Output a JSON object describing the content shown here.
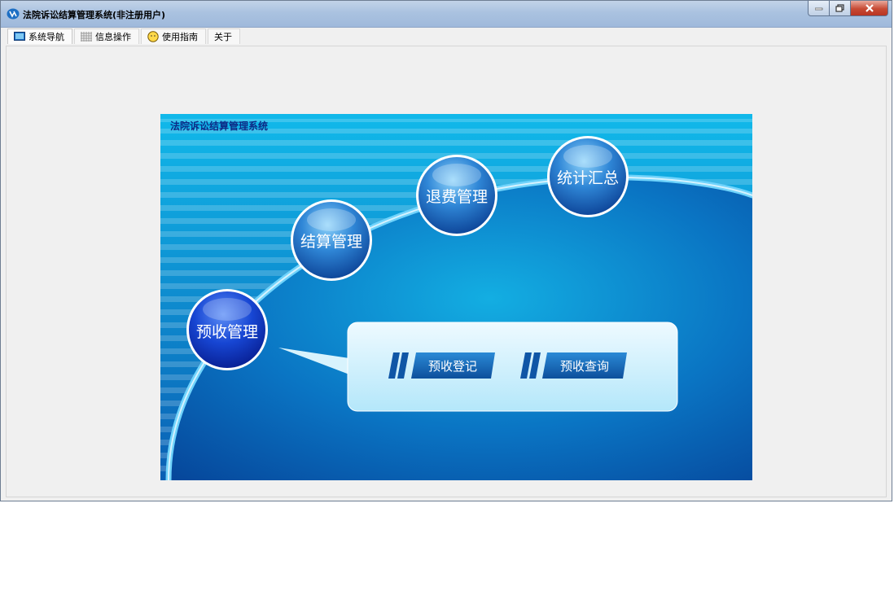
{
  "window": {
    "title": "法院诉讼结算管理系统(非注册用户)"
  },
  "menu": [
    {
      "label": "系统导航",
      "icon": "monitor-icon"
    },
    {
      "label": "信息操作",
      "icon": "grid-icon"
    },
    {
      "label": "使用指南",
      "icon": "help-smiley-icon"
    },
    {
      "label": "关于",
      "icon": ""
    }
  ],
  "banner": {
    "title": "法院诉讼结算管理系统",
    "circles": [
      "预收管理",
      "结算管理",
      "退费管理",
      "统计汇总"
    ],
    "actions": [
      "预收登记",
      "预收查询"
    ]
  },
  "colors": {
    "accent": "#0a63b4",
    "banner_dark": "#064a9e",
    "banner_light": "#12b5e6"
  }
}
